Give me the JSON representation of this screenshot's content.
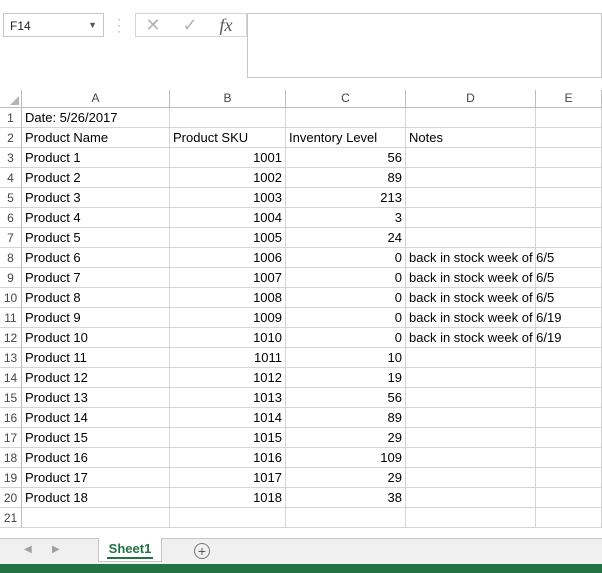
{
  "formula_bar": {
    "name_box": "F14",
    "formula_value": ""
  },
  "icons": {
    "cancel": "close-icon",
    "enter": "check-icon",
    "function": "fx-icon"
  },
  "columns": [
    "A",
    "B",
    "C",
    "D",
    "E"
  ],
  "rows": [
    [
      "Date: 5/26/2017",
      "",
      "",
      "",
      ""
    ],
    [
      "Product Name",
      "Product SKU",
      "Inventory Level",
      "Notes",
      ""
    ],
    [
      "Product 1",
      "1001",
      "56",
      "",
      ""
    ],
    [
      "Product 2",
      "1002",
      "89",
      "",
      ""
    ],
    [
      "Product 3",
      "1003",
      "213",
      "",
      ""
    ],
    [
      "Product 4",
      "1004",
      "3",
      "",
      ""
    ],
    [
      "Product 5",
      "1005",
      "24",
      "",
      ""
    ],
    [
      "Product 6",
      "1006",
      "0",
      "back in stock week of 6/5",
      ""
    ],
    [
      "Product 7",
      "1007",
      "0",
      "back in stock week of 6/5",
      ""
    ],
    [
      "Product 8",
      "1008",
      "0",
      "back in stock week of 6/5",
      ""
    ],
    [
      "Product 9",
      "1009",
      "0",
      "back in stock week of 6/19",
      ""
    ],
    [
      "Product 10",
      "1010",
      "0",
      "back in stock week of 6/19",
      ""
    ],
    [
      "Product 11",
      "1011",
      "10",
      "",
      ""
    ],
    [
      "Product 12",
      "1012",
      "19",
      "",
      ""
    ],
    [
      "Product 13",
      "1013",
      "56",
      "",
      ""
    ],
    [
      "Product 14",
      "1014",
      "89",
      "",
      ""
    ],
    [
      "Product 15",
      "1015",
      "29",
      "",
      ""
    ],
    [
      "Product 16",
      "1016",
      "109",
      "",
      ""
    ],
    [
      "Product 17",
      "1017",
      "29",
      "",
      ""
    ],
    [
      "Product 18",
      "1018",
      "38",
      "",
      ""
    ],
    [
      "",
      "",
      "",
      "",
      ""
    ]
  ],
  "sheets": [
    "Sheet1"
  ],
  "accent_color": "#217346"
}
